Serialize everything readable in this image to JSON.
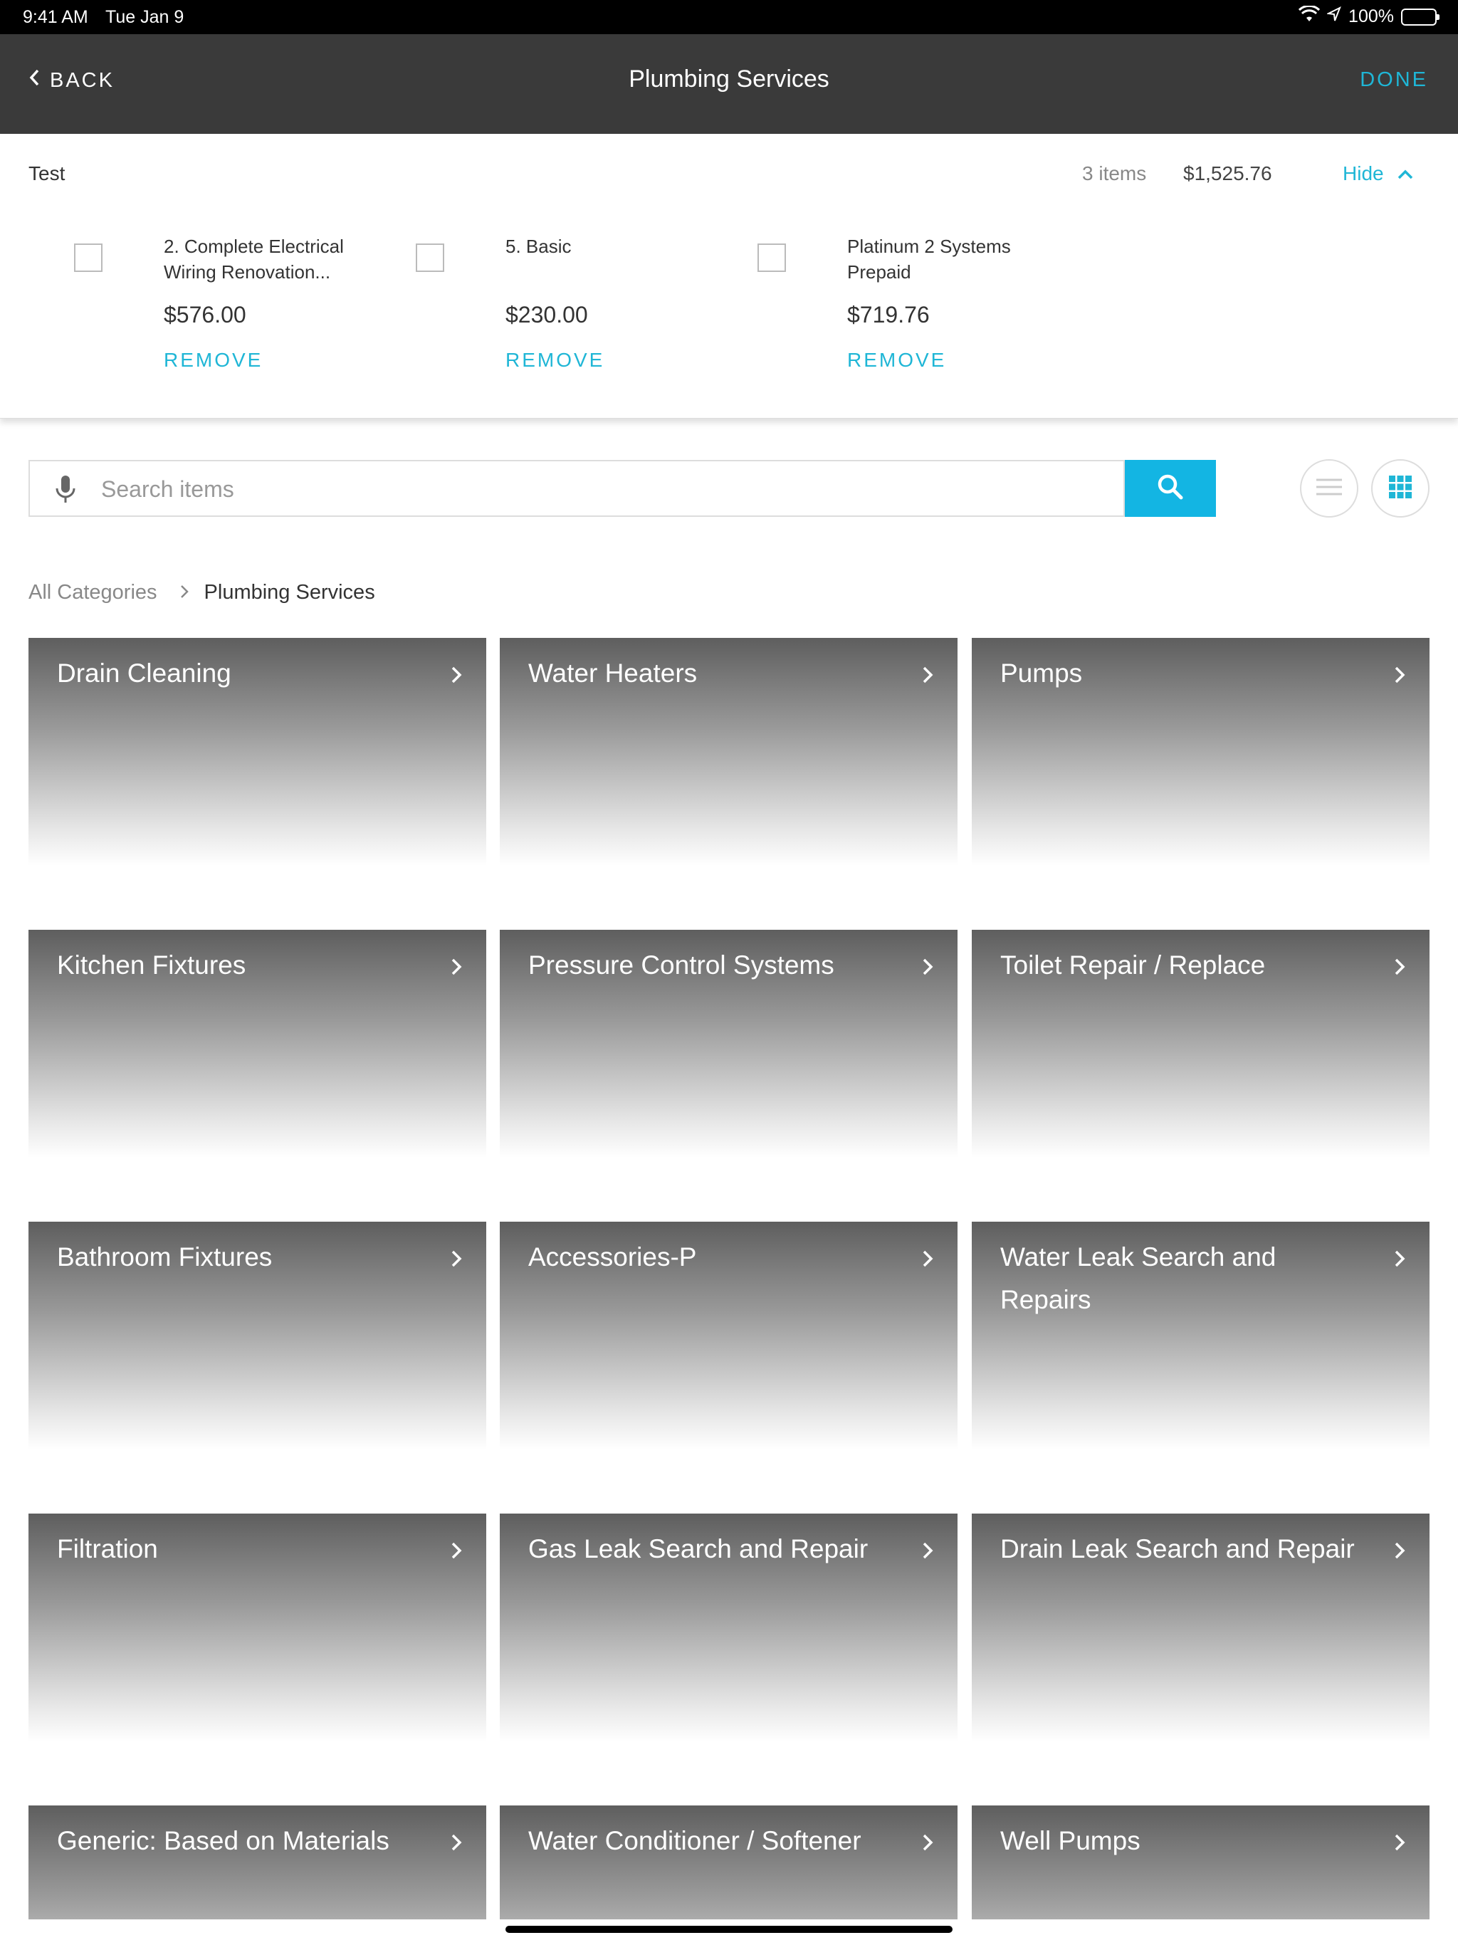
{
  "status_bar": {
    "time": "9:41 AM",
    "date": "Tue Jan 9",
    "battery": "100%"
  },
  "nav": {
    "back_label": "BACK",
    "title": "Plumbing Services",
    "done_label": "DONE"
  },
  "cart": {
    "name": "Test",
    "item_count": "3 items",
    "total": "$1,525.76",
    "hide_label": "Hide",
    "items": [
      {
        "name": "2. Complete Electrical Wiring Renovation...",
        "price": "$576.00",
        "remove_label": "REMOVE"
      },
      {
        "name": "5. Basic",
        "price": "$230.00",
        "remove_label": "REMOVE"
      },
      {
        "name": "Platinum 2 Systems Prepaid",
        "price": "$719.76",
        "remove_label": "REMOVE"
      }
    ]
  },
  "search": {
    "placeholder": "Search items",
    "value": ""
  },
  "breadcrumb": {
    "root": "All Categories",
    "separator": ">",
    "current": "Plumbing Services"
  },
  "categories": [
    "Drain Cleaning",
    "Water Heaters",
    "Pumps",
    "Kitchen Fixtures",
    "Pressure Control Systems",
    "Toilet Repair / Replace",
    "Bathroom Fixtures",
    "Accessories-P",
    "Water Leak Search and Repairs",
    "Filtration",
    "Gas Leak Search and Repair",
    "Drain Leak Search and Repair",
    "Generic: Based on Materials",
    "Water Conditioner / Softener",
    "Well Pumps"
  ],
  "colors": {
    "accent": "#1fb6d6",
    "search_button": "#13b5e3",
    "nav_background": "#3a3a3a",
    "battery": "#4cd964"
  }
}
